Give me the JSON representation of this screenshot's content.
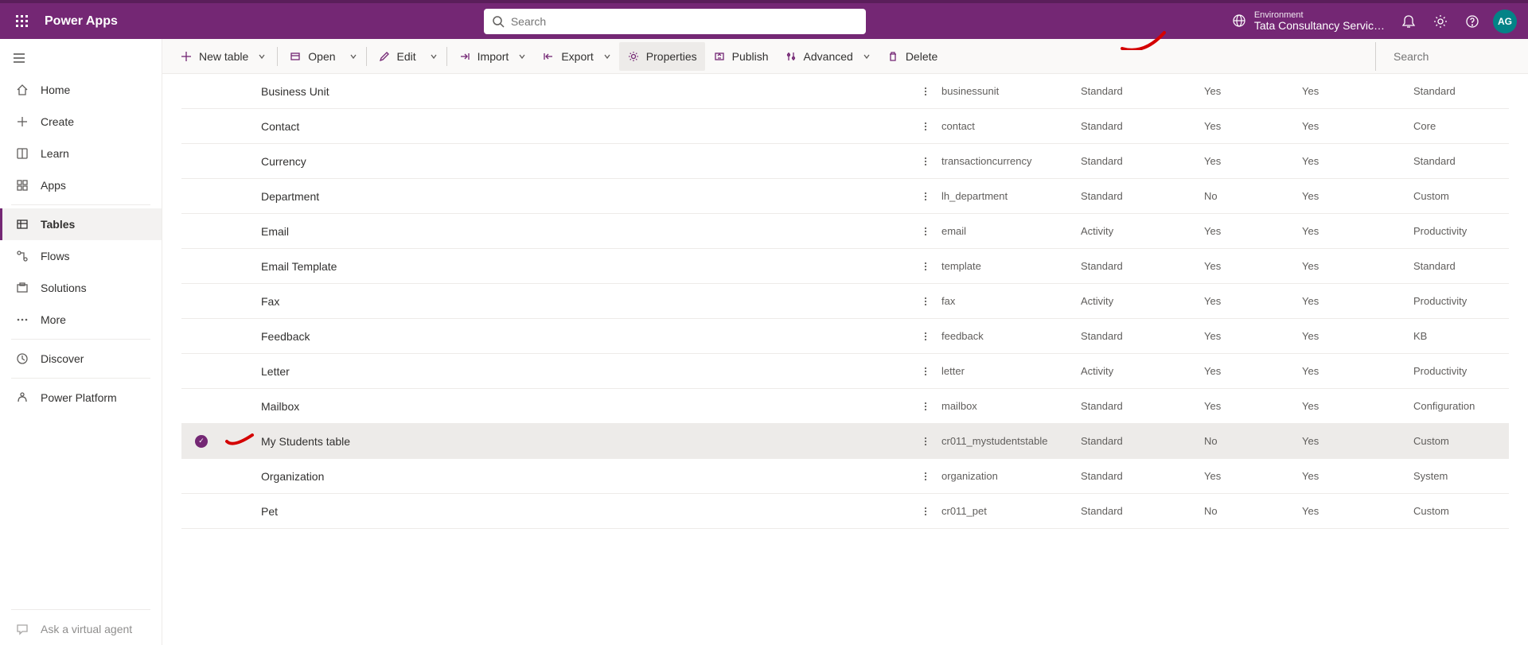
{
  "header": {
    "app_title": "Power Apps",
    "search_placeholder": "Search",
    "env_label": "Environment",
    "env_name": "Tata Consultancy Servic…",
    "avatar_initials": "AG"
  },
  "sidebar": {
    "items": [
      {
        "id": "home",
        "label": "Home",
        "icon": "home"
      },
      {
        "id": "create",
        "label": "Create",
        "icon": "plus"
      },
      {
        "id": "learn",
        "label": "Learn",
        "icon": "book"
      },
      {
        "id": "apps",
        "label": "Apps",
        "icon": "grid"
      }
    ],
    "section2": [
      {
        "id": "tables",
        "label": "Tables",
        "icon": "table",
        "active": true
      },
      {
        "id": "flows",
        "label": "Flows",
        "icon": "flow"
      },
      {
        "id": "solutions",
        "label": "Solutions",
        "icon": "solution"
      },
      {
        "id": "more",
        "label": "More",
        "icon": "dots"
      }
    ],
    "section3": [
      {
        "id": "discover",
        "label": "Discover",
        "icon": "clock"
      }
    ],
    "section4": [
      {
        "id": "powerplatform",
        "label": "Power Platform",
        "icon": "pp"
      }
    ],
    "ask_agent": "Ask a virtual agent"
  },
  "toolbar": {
    "new_table": "New table",
    "open": "Open",
    "edit": "Edit",
    "import": "Import",
    "export": "Export",
    "properties": "Properties",
    "publish": "Publish",
    "advanced": "Advanced",
    "delete": "Delete",
    "search_placeholder": "Search"
  },
  "rows": [
    {
      "tname": "Business Unit",
      "name": "businessunit",
      "type": "Standard",
      "yn1": "Yes",
      "yn2": "Yes",
      "cat": "Standard"
    },
    {
      "tname": "Contact",
      "name": "contact",
      "type": "Standard",
      "yn1": "Yes",
      "yn2": "Yes",
      "cat": "Core"
    },
    {
      "tname": "Currency",
      "name": "transactioncurrency",
      "type": "Standard",
      "yn1": "Yes",
      "yn2": "Yes",
      "cat": "Standard"
    },
    {
      "tname": "Department",
      "name": "lh_department",
      "type": "Standard",
      "yn1": "No",
      "yn2": "Yes",
      "cat": "Custom"
    },
    {
      "tname": "Email",
      "name": "email",
      "type": "Activity",
      "yn1": "Yes",
      "yn2": "Yes",
      "cat": "Productivity"
    },
    {
      "tname": "Email Template",
      "name": "template",
      "type": "Standard",
      "yn1": "Yes",
      "yn2": "Yes",
      "cat": "Standard"
    },
    {
      "tname": "Fax",
      "name": "fax",
      "type": "Activity",
      "yn1": "Yes",
      "yn2": "Yes",
      "cat": "Productivity"
    },
    {
      "tname": "Feedback",
      "name": "feedback",
      "type": "Standard",
      "yn1": "Yes",
      "yn2": "Yes",
      "cat": "KB"
    },
    {
      "tname": "Letter",
      "name": "letter",
      "type": "Activity",
      "yn1": "Yes",
      "yn2": "Yes",
      "cat": "Productivity"
    },
    {
      "tname": "Mailbox",
      "name": "mailbox",
      "type": "Standard",
      "yn1": "Yes",
      "yn2": "Yes",
      "cat": "Configuration"
    },
    {
      "tname": "My Students table",
      "name": "cr011_mystudentstable",
      "type": "Standard",
      "yn1": "No",
      "yn2": "Yes",
      "cat": "Custom",
      "selected": true
    },
    {
      "tname": "Organization",
      "name": "organization",
      "type": "Standard",
      "yn1": "Yes",
      "yn2": "Yes",
      "cat": "System"
    },
    {
      "tname": "Pet",
      "name": "cr011_pet",
      "type": "Standard",
      "yn1": "No",
      "yn2": "Yes",
      "cat": "Custom"
    }
  ]
}
